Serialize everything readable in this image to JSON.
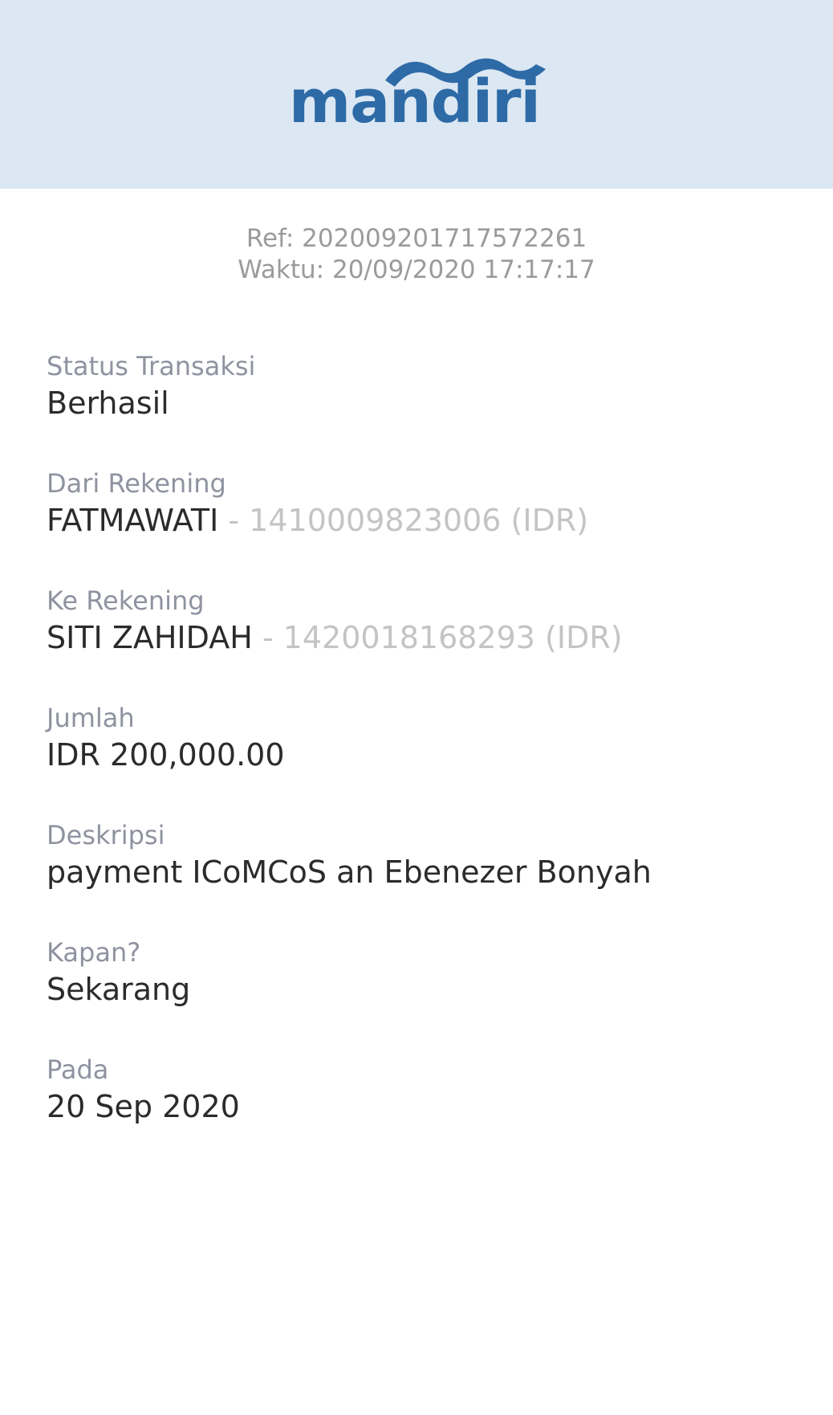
{
  "brand": {
    "logo_text": "mandiri",
    "logo_color": "#2d6aa6",
    "header_bg": "#dbe7f3"
  },
  "meta": {
    "ref": "Ref: 202009201717572261",
    "time": "Waktu: 20/09/2020 17:17:17"
  },
  "fields": [
    {
      "label": "Status Transaksi",
      "value": "Berhasil"
    },
    {
      "label": "Dari Rekening",
      "value": "FATMAWATI",
      "account": " - 1410009823006 (IDR)"
    },
    {
      "label": "Ke Rekening",
      "value": "SITI ZAHIDAH",
      "account": " - 1420018168293 (IDR)"
    },
    {
      "label": "Jumlah",
      "value": "IDR 200,000.00"
    },
    {
      "label": "Deskripsi",
      "value": "payment ICoMCoS an Ebenezer Bonyah"
    },
    {
      "label": "Kapan?",
      "value": "Sekarang"
    },
    {
      "label": "Pada",
      "value": "20 Sep 2020"
    }
  ]
}
